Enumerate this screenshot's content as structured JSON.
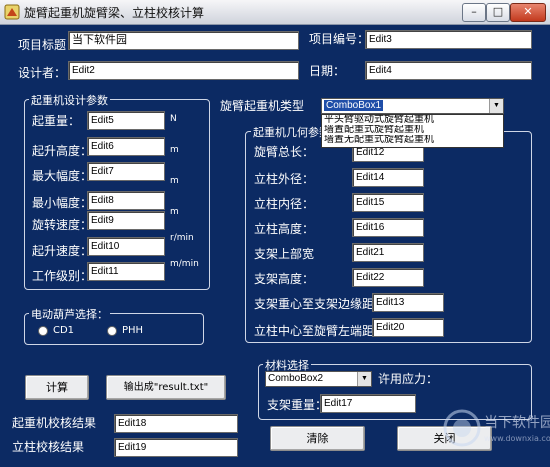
{
  "window": {
    "title": "旋臂起重机旋臂梁、立柱校核计算",
    "controls": {
      "minimize": "–",
      "maximize": "□",
      "close": "✕"
    }
  },
  "top": {
    "project_title_label": "项目标题：",
    "project_title_value": "当下软件园",
    "project_no_label": "项目编号：",
    "project_no_value": "Edit3",
    "designer_label": "设计者：",
    "designer_value": "Edit2",
    "date_label": "日期：",
    "date_value": "Edit4"
  },
  "crane_params": {
    "group_title": "起重机设计参数",
    "rows": [
      {
        "label": "起重量：",
        "value": "Edit5",
        "unit": "N"
      },
      {
        "label": "起升高度：",
        "value": "Edit6",
        "unit": "m"
      },
      {
        "label": "最大幅度：",
        "value": "Edit7",
        "unit": "m"
      },
      {
        "label": "最小幅度：",
        "value": "Edit8",
        "unit": "m"
      },
      {
        "label": "旋转速度：",
        "value": "Edit9",
        "unit": "r/min"
      },
      {
        "label": "起升速度：",
        "value": "Edit10",
        "unit": "m/min"
      },
      {
        "label": "工作级别：",
        "value": "Edit11",
        "unit": ""
      }
    ]
  },
  "crane_type": {
    "label": "旋臂起重机类型",
    "selected": "ComboBox1",
    "options": [
      "平头臂驱动式旋臂起重机",
      "墙置配重式旋臂起重机",
      "墙置无配重式旋臂起重机"
    ]
  },
  "geometry": {
    "group_title": "起重机几何参数",
    "rows": [
      {
        "label": "旋臂总长：",
        "value": "Edit12"
      },
      {
        "label": "立柱外径：",
        "value": "Edit14"
      },
      {
        "label": "立柱内径：",
        "value": "Edit15"
      },
      {
        "label": "立柱高度：",
        "value": "Edit16"
      },
      {
        "label": "支架上部宽",
        "value": "Edit21"
      },
      {
        "label": "支架高度：",
        "value": "Edit22"
      },
      {
        "label": "支架重心至支架边缘距：",
        "value": "Edit13"
      },
      {
        "label": "立柱中心至旋臂左端距：",
        "value": "Edit20"
      }
    ]
  },
  "hoist": {
    "group_title": "电动葫芦选择：",
    "options": [
      "CD1",
      "PHH"
    ]
  },
  "material": {
    "group_title": "材料选择",
    "combo_value": "ComboBox2",
    "allowable_stress_label": "许用应力：",
    "bracket_weight_label": "支架重量：",
    "bracket_weight_value": "Edit17"
  },
  "actions": {
    "calc_label": "计算",
    "output_label": "输出成\"result.txt\"",
    "clear_label": "清除",
    "close_label": "关闭"
  },
  "results": {
    "crane_result_label": "起重机校核结果",
    "crane_result_value": "Edit18",
    "column_result_label": "立柱校核结果",
    "column_result_value": "Edit19"
  },
  "watermark": {
    "title": "当下软件园",
    "subtitle": "www.downxia.com"
  }
}
